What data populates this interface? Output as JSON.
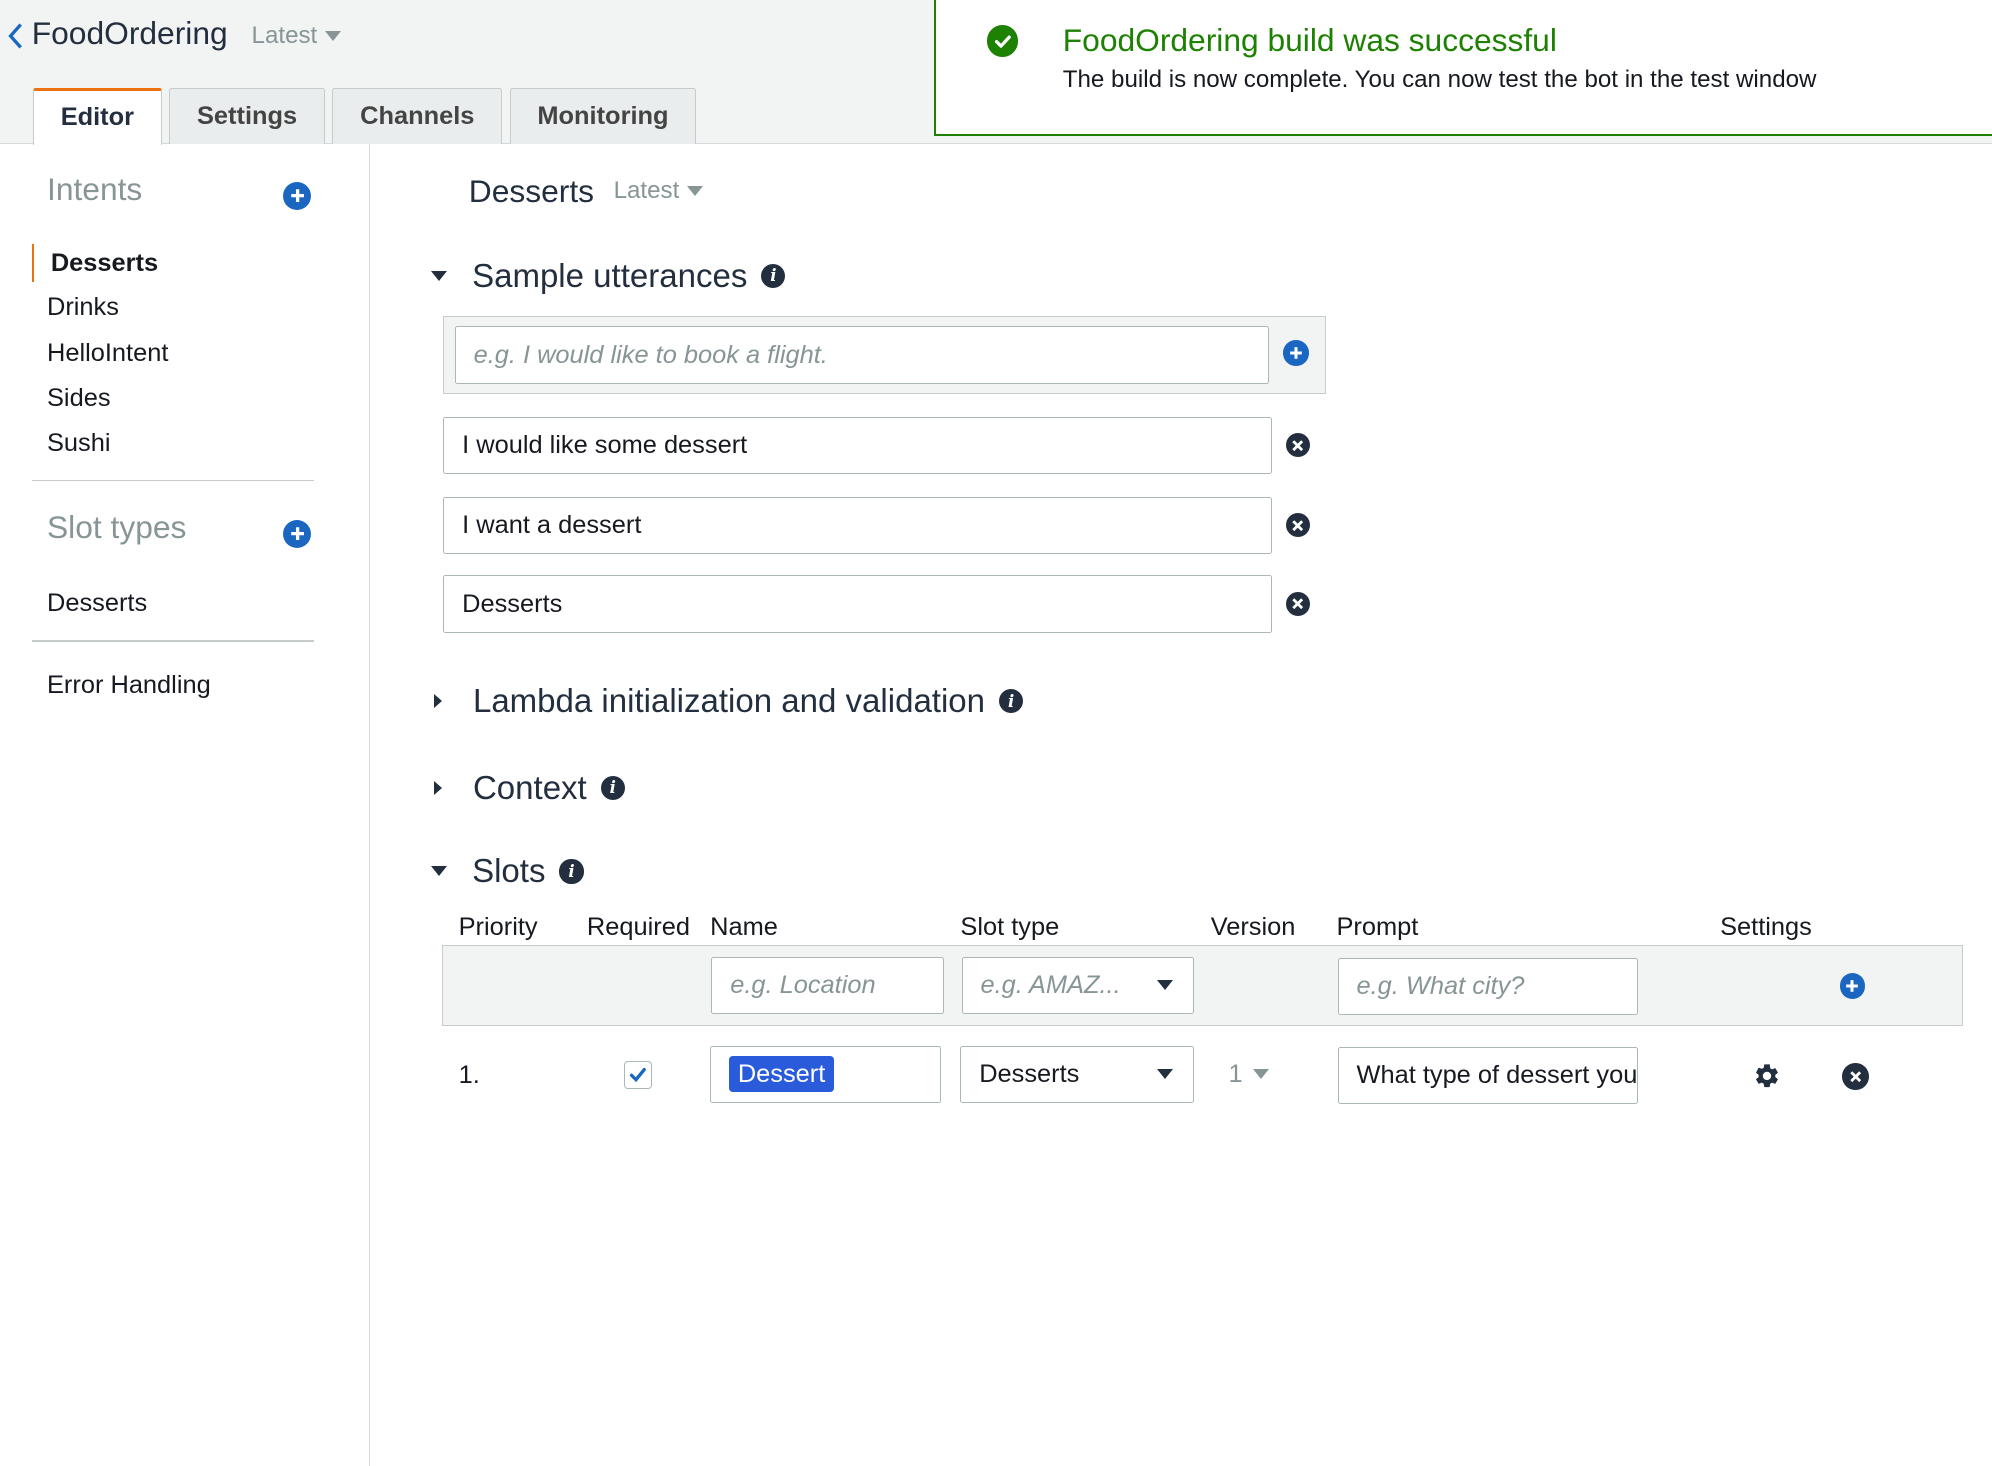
{
  "header": {
    "app_title": "FoodOrdering",
    "version": "Latest",
    "tabs": [
      "Editor",
      "Settings",
      "Channels",
      "Monitoring"
    ]
  },
  "flash": {
    "title": "FoodOrdering build was successful",
    "message": "The build is now complete. You can now test the bot in the test window",
    "color": "#1d8102"
  },
  "sidebar": {
    "intents_heading": "Intents",
    "intents": [
      "Desserts",
      "Drinks",
      "HelloIntent",
      "Sides",
      "Sushi"
    ],
    "slot_types_heading": "Slot types",
    "slot_types": [
      "Desserts"
    ],
    "error_handling": "Error Handling"
  },
  "main": {
    "intent_name": "Desserts",
    "intent_version": "Latest",
    "sample_utterances": {
      "title": "Sample utterances",
      "placeholder": "e.g. I would like to book a flight.",
      "items": [
        "I would like some dessert",
        "I want a dessert",
        "Desserts"
      ]
    },
    "lambda_title": "Lambda initialization and validation",
    "context_title": "Context",
    "slots": {
      "title": "Slots",
      "columns": [
        "Priority",
        "Required",
        "Name",
        "Slot type",
        "Version",
        "Prompt",
        "Settings"
      ],
      "new_row": {
        "name_placeholder": "e.g. Location",
        "slot_type_placeholder": "e.g. AMAZ...",
        "prompt_placeholder": "e.g. What city?"
      },
      "rows": [
        {
          "priority": "1.",
          "required": true,
          "name": "Dessert",
          "slot_type": "Desserts",
          "version": "1",
          "prompt": "What type of dessert you"
        }
      ]
    }
  },
  "colors": {
    "accent": "#ec7211",
    "link_blue": "#1a66c1",
    "success": "#1d8102",
    "token_blue": "#2a5bdb"
  },
  "icons": {
    "back": "chevron-left-icon",
    "success": "check-circle-icon",
    "add": "plus-circle-icon",
    "remove": "x-circle-icon",
    "info": "info-circle-icon",
    "settings": "gear-icon"
  }
}
